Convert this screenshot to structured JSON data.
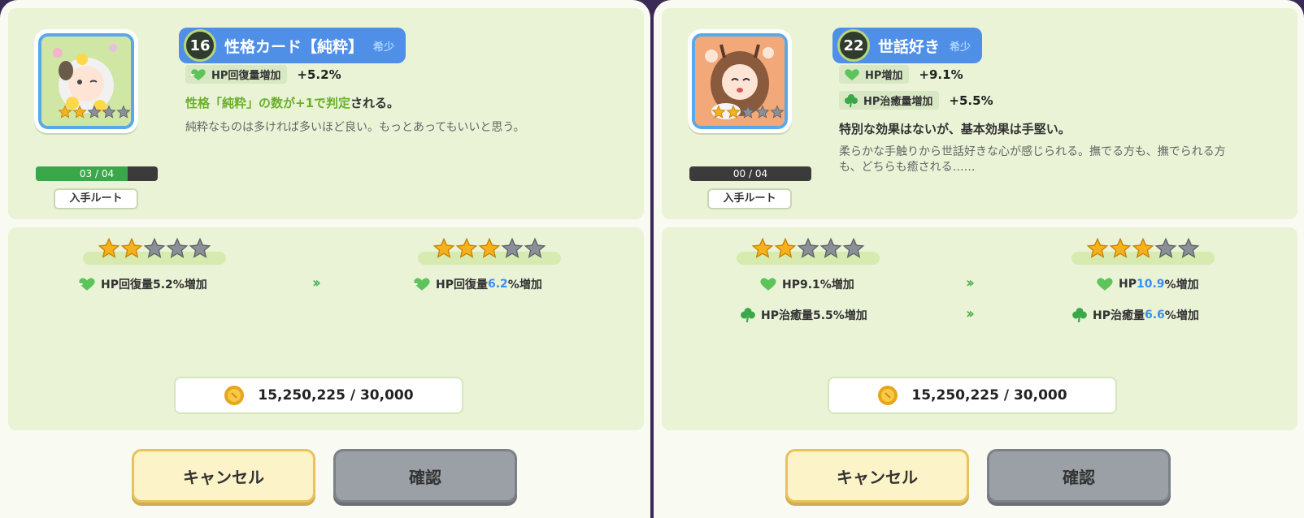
{
  "panels": [
    {
      "close_icon": "close-icon",
      "level": "16",
      "title": "性格カード【純粋】",
      "rarity": "希少",
      "progress": {
        "text": "03 / 04",
        "fraction": 0.75
      },
      "route_label": "入手ルート",
      "card_rank": {
        "filled": 2,
        "total": 5
      },
      "stats": [
        {
          "icon": "heart-recover-icon",
          "label": "HP回復量増加",
          "value": "+5.2%"
        }
      ],
      "effect": {
        "highlight": "性格「純粋」の数が+1で判定",
        "rest": "される。"
      },
      "description": "純粋なものは多ければ多いほど良い。もっとあってもいいと思う。",
      "upgrade": {
        "from_stars": 2,
        "to_stars": 3,
        "total_stars": 5,
        "lines": [
          {
            "icon": "heart-recover-icon",
            "from": "HP回復量5.2%増加",
            "to_prefix": "HP回復量",
            "to_value": "6.2",
            "to_suffix": "%増加"
          }
        ]
      },
      "coins": "15,250,225 / 30,000",
      "cancel_label": "キャンセル",
      "confirm_label": "確認"
    },
    {
      "close_icon": "close-icon",
      "level": "22",
      "title": "世話好き",
      "rarity": "希少",
      "progress": {
        "text": "00 / 04",
        "fraction": 0
      },
      "route_label": "入手ルート",
      "card_rank": {
        "filled": 2,
        "total": 5
      },
      "stats": [
        {
          "icon": "heart-icon",
          "label": "HP増加",
          "value": "+9.1%"
        },
        {
          "icon": "clover-icon",
          "label": "HP治癒量増加",
          "value": "+5.5%"
        }
      ],
      "effect": {
        "highlight": "",
        "rest": "特別な効果はないが、基本効果は手堅い。"
      },
      "description": "柔らかな手触りから世話好きな心が感じられる。撫でる方も、撫でられる方も、どちらも癒される……",
      "upgrade": {
        "from_stars": 2,
        "to_stars": 3,
        "total_stars": 5,
        "lines": [
          {
            "icon": "heart-icon",
            "from": "HP9.1%増加",
            "to_prefix": "HP",
            "to_value": "10.9",
            "to_suffix": "%増加"
          },
          {
            "icon": "clover-icon",
            "from": "HP治癒量5.5%増加",
            "to_prefix": "HP治癒量",
            "to_value": "6.6",
            "to_suffix": "%増加"
          }
        ]
      },
      "coins": "15,250,225 / 30,000",
      "cancel_label": "キャンセル",
      "confirm_label": "確認"
    }
  ],
  "colors": {
    "accent_blue": "#4f8fe8",
    "highlight_green": "#6ab02c",
    "value_blue": "#3b8ef0",
    "panel_green": "#eaf3d6"
  }
}
